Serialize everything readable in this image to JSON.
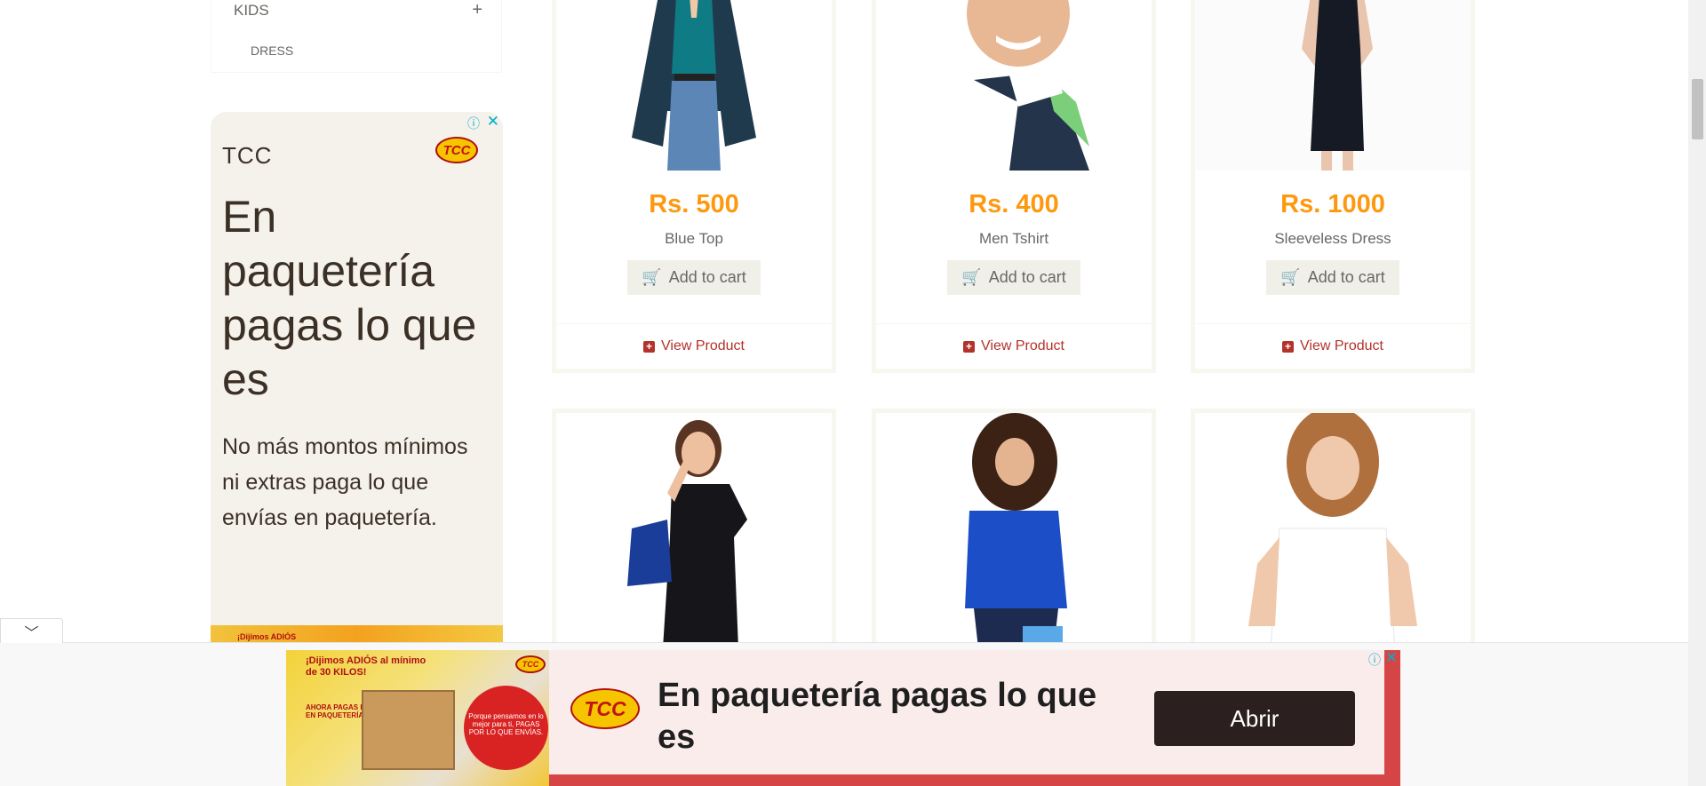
{
  "sidebar": {
    "category": {
      "label": "KIDS",
      "expand_icon": "+"
    },
    "subcategory_partial": "DRESS"
  },
  "side_ad": {
    "brand": "TCC",
    "logo_text": "TCC",
    "headline": "En paquetería pagas lo que es",
    "body": "No más montos mínimos ni extras paga lo que envías en paquetería.",
    "promo_text": "¡Dijimos ADIÓS"
  },
  "products": [
    {
      "price": "Rs. 500",
      "name": "Blue Top",
      "cart_label": "Add to cart",
      "view_label": "View Product"
    },
    {
      "price": "Rs. 400",
      "name": "Men Tshirt",
      "cart_label": "Add to cart",
      "view_label": "View Product"
    },
    {
      "price": "Rs. 1000",
      "name": "Sleeveless Dress",
      "cart_label": "Add to cart",
      "view_label": "View Product"
    }
  ],
  "bottom_ad": {
    "promo_heading": "¡Dijimos ADIÓS al mínimo de 30 KILOS!",
    "promo_sub": "AHORA PAGAS KILO A KILO EN PAQUETERÍA",
    "circle_text": "Porque pensamos en lo mejor para ti, PAGAS POR LO QUE ENVÍAS.",
    "logo_text": "TCC",
    "headline": "En paquetería pagas lo que es",
    "button_label": "Abrir"
  },
  "colors": {
    "price": "#fe980f",
    "view_product": "#b3322b",
    "ad_button": "#2b1f1f",
    "ad_frame": "#d64545"
  },
  "icons": {
    "cart": "shopping-cart-icon",
    "plus": "plus-square-icon",
    "adchoices": "info-icon",
    "close": "close-icon",
    "collapse": "chevron-down-icon"
  }
}
